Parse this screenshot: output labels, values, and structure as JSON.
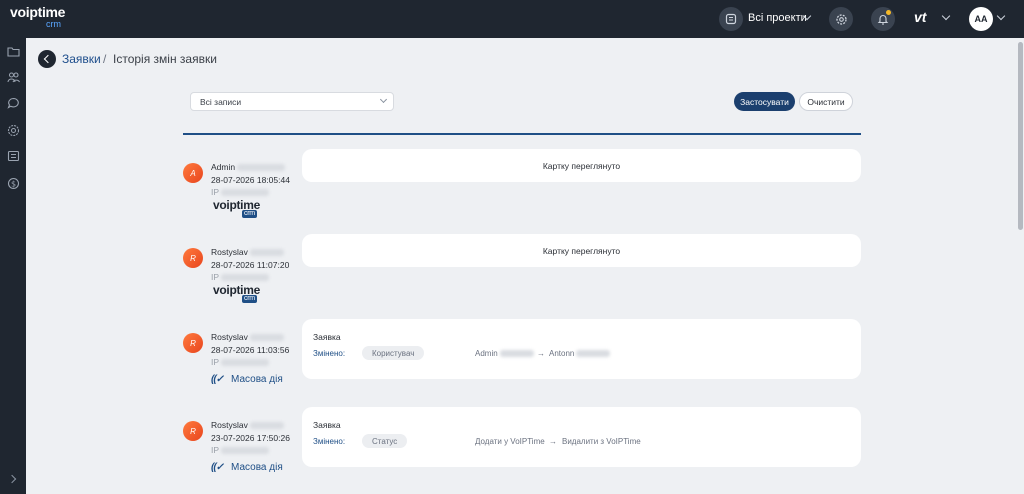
{
  "header": {
    "logo_text": "voiptime",
    "logo_sub": "crm",
    "projects_label": "Всі проекти",
    "vt_logo": "vt",
    "user_initials": "AA",
    "colors": {
      "bar": "#1f2630",
      "accent": "#1f4f86",
      "notification": "#f5b928"
    }
  },
  "sidebar": {
    "items": [
      "folder-icon",
      "users-icon",
      "chat-icon",
      "gear-badge-icon",
      "document-list-icon",
      "money-icon"
    ]
  },
  "breadcrumb": {
    "parent": "Заявки",
    "separator": "/",
    "current": "Історія змін заявки"
  },
  "filter": {
    "select_value": "Всі записи",
    "apply_label": "Застосувати",
    "clear_label": "Очистити"
  },
  "entries": [
    {
      "initial": "A",
      "user": "Admin",
      "datetime": "28-07-2026 18:05:44",
      "ip_label": "IP",
      "source": "voiptime",
      "source_sub": "crm",
      "message": "Картку переглянуто"
    },
    {
      "initial": "R",
      "user": "Rostyslav",
      "datetime": "28-07-2026 11:07:20",
      "ip_label": "IP",
      "source": "voiptime",
      "source_sub": "crm",
      "message": "Картку переглянуто"
    },
    {
      "initial": "R",
      "user": "Rostyslav",
      "datetime": "28-07-2026 11:03:56",
      "ip_label": "IP",
      "source_label": "Масова дія",
      "source_icon": "((✓",
      "title": "Заявка",
      "changed_label": "Змінено:",
      "field": "Користувач",
      "old_value": "Admin",
      "arrow": "→",
      "new_value": "Antonn"
    },
    {
      "initial": "R",
      "user": "Rostyslav",
      "datetime": "23-07-2026 17:50:26",
      "ip_label": "IP",
      "source_label": "Масова дія",
      "source_icon": "((✓",
      "title": "Заявка",
      "changed_label": "Змінено:",
      "field": "Статус",
      "old_value": "Додати у VoIPTime",
      "arrow": "→",
      "new_value": "Видалити з VoIPTime"
    }
  ]
}
